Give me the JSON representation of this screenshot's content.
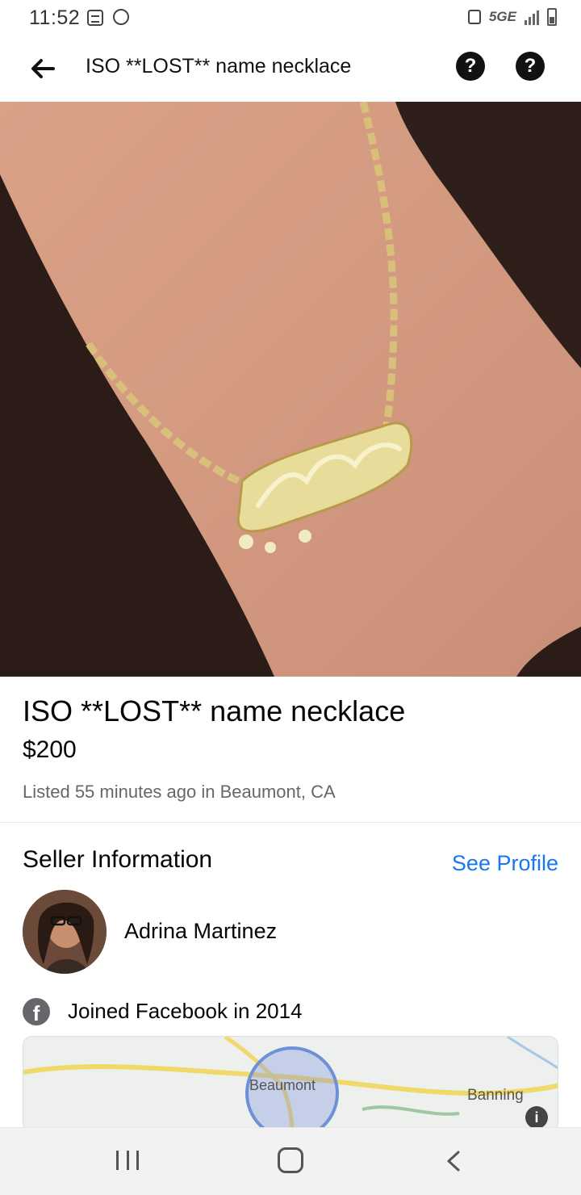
{
  "status_bar": {
    "time": "11:52",
    "network": "5GE"
  },
  "header": {
    "title": "ISO **LOST** name necklace",
    "help_symbol": "?"
  },
  "listing": {
    "title": "ISO **LOST** name necklace",
    "price": "$200",
    "meta": "Listed 55 minutes ago in Beaumont, CA"
  },
  "seller": {
    "heading": "Seller Information",
    "see_profile": "See Profile",
    "name": "Adrina Martinez",
    "joined": "Joined Facebook in 2014"
  },
  "map": {
    "labels": [
      "Beaumont",
      "Banning"
    ],
    "info_symbol": "i"
  },
  "colors": {
    "link": "#1877f2",
    "text_primary": "#050505",
    "text_secondary": "#65676b"
  },
  "icons": [
    "back-arrow-icon",
    "help-icon",
    "facebook-icon",
    "info-icon",
    "recents-icon",
    "home-icon",
    "nav-back-icon"
  ]
}
